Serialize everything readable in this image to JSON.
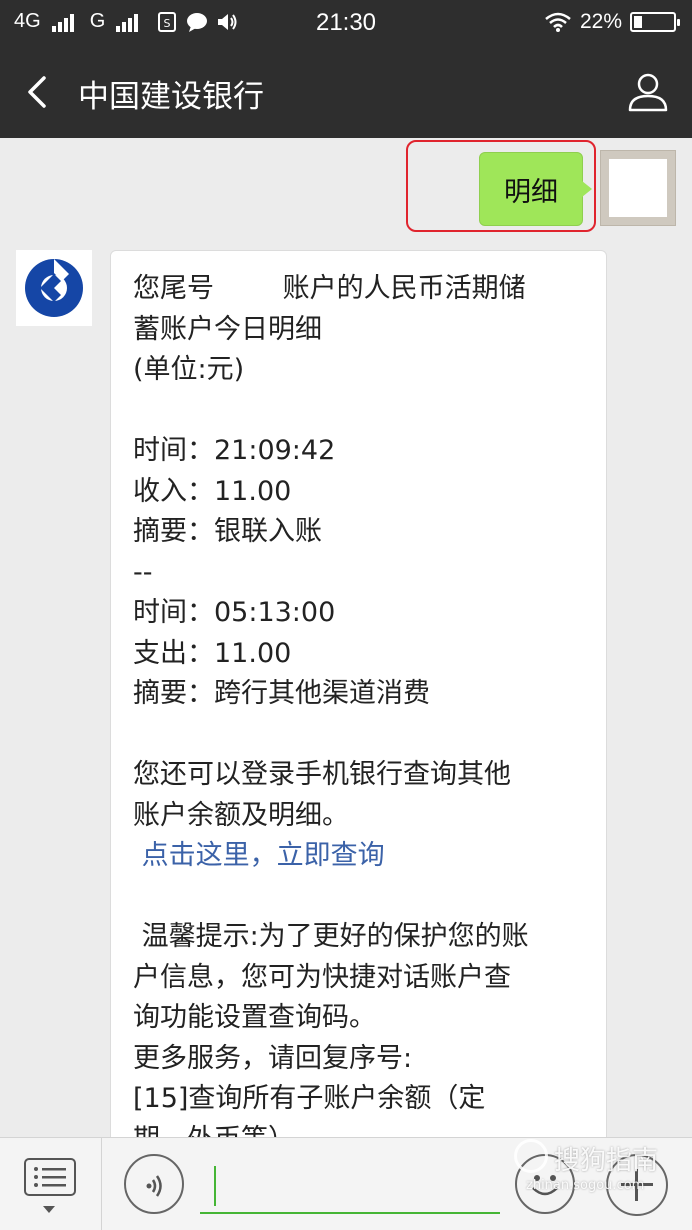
{
  "status_bar": {
    "network1": "4G",
    "network2": "G",
    "time": "21:30",
    "battery_text": "22%",
    "battery_level": 0.22,
    "icons": [
      "signal-icon",
      "sim-icon",
      "chat-icon",
      "speaker-icon",
      "wifi-icon",
      "battery-icon"
    ]
  },
  "header": {
    "title": "中国建设银行",
    "back_icon": "chevron-left-icon",
    "profile_icon": "person-icon"
  },
  "outgoing_message": {
    "text": "明细"
  },
  "incoming_message": {
    "lines": [
      "您尾号        账户的人民币活期储",
      "蓄账户今日明细",
      "(单位:元)",
      "",
      "时间：21:09:42",
      "收入：11.00",
      "摘要：银联入账",
      "--",
      "时间：05:13:00",
      "支出：11.00",
      "摘要：跨行其他渠道消费",
      "",
      "您还可以登录手机银行查询其他",
      "账户余额及明细。",
      " 点击这里，立即查询",
      "",
      " 温馨提示:为了更好的保护您的账",
      "户信息，您可为快捷对话账户查",
      "询功能设置查询码。",
      "更多服务，请回复序号:",
      "[15]查询所有子账户余额（定",
      "期、外币等）"
    ],
    "link_text": " 点击这里，立即查询"
  },
  "input_bar": {
    "menu_icon": "menu-list-icon",
    "voice_icon": "voice-icon",
    "emoji_icon": "emoji-icon",
    "plus_icon": "plus-icon",
    "input_value": ""
  },
  "watermark": {
    "text": "搜狗指南",
    "sub": "zhinan.sogou.com"
  },
  "colors": {
    "bar_bg": "#2e2e2e",
    "chat_bg": "#ececec",
    "outgoing_bubble": "#9fe659",
    "highlight_border": "#e0242e",
    "link": "#3b62a8",
    "bank_blue": "#1546a6",
    "input_accent": "#45b535"
  }
}
